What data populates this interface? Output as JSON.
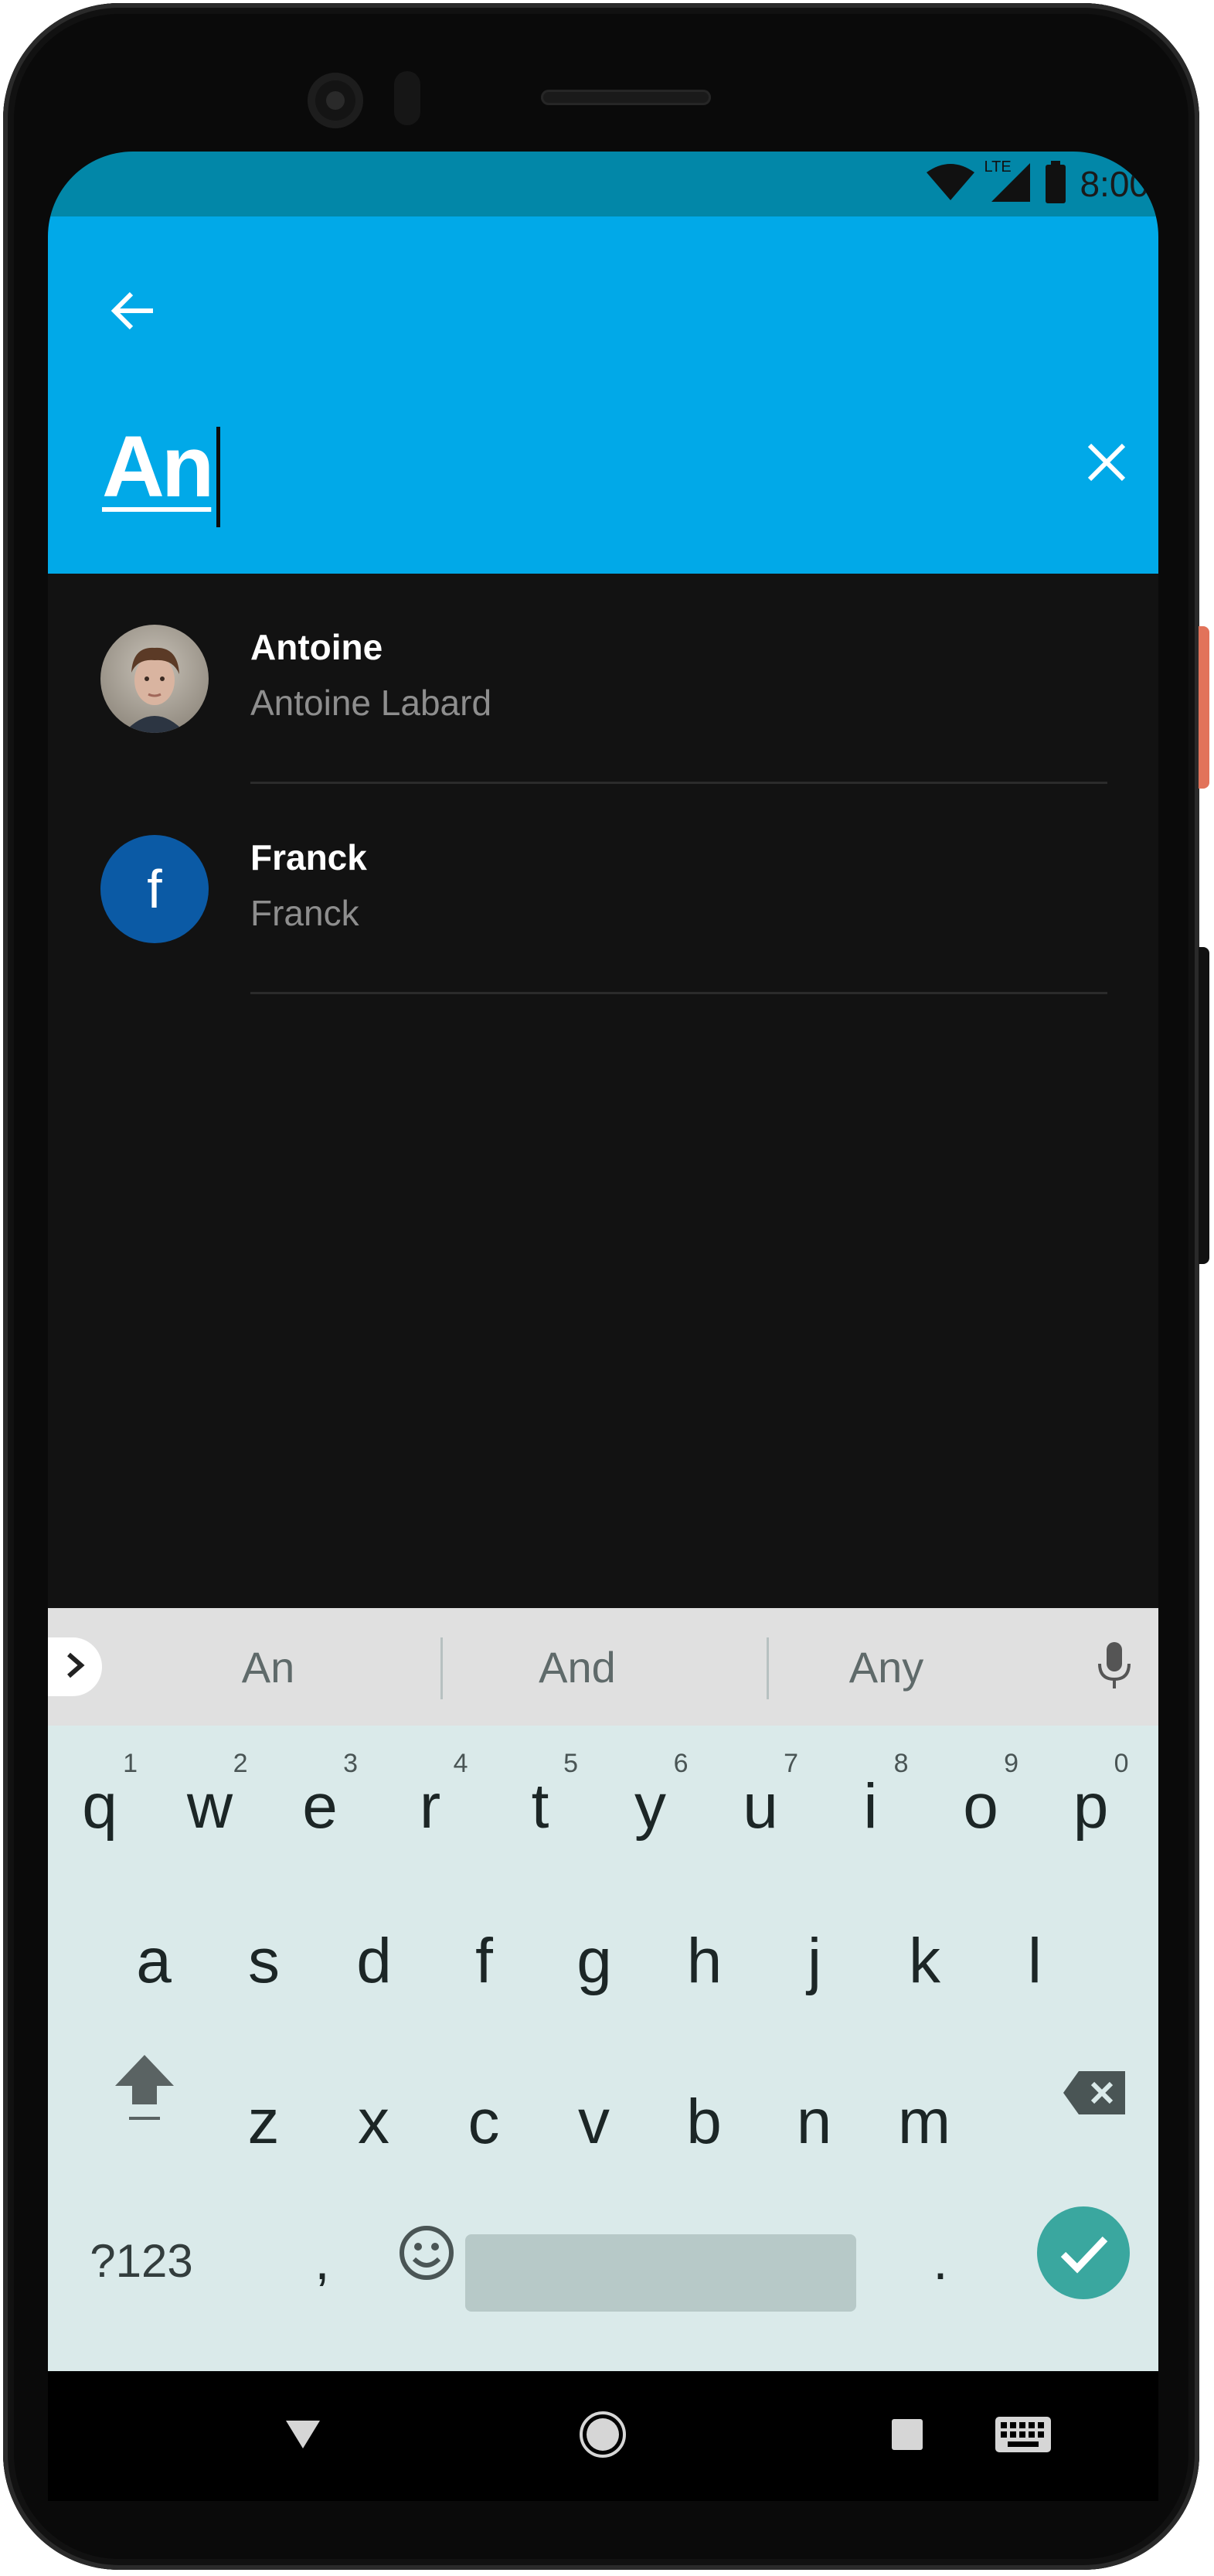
{
  "status_bar": {
    "time": "8:00",
    "network_label": "LTE",
    "icons": [
      "wifi-icon",
      "cell-signal-icon",
      "battery-icon"
    ]
  },
  "app_bar": {
    "search_query": "An",
    "icons": [
      "back-arrow-icon",
      "close-icon"
    ]
  },
  "results": [
    {
      "title": "Antoine",
      "subtitle": "Antoine Labard",
      "avatar": "photo"
    },
    {
      "title": "Franck",
      "subtitle": "Franck",
      "avatar_initial": "f"
    }
  ],
  "keyboard": {
    "suggestions": [
      "An",
      "And",
      "Any"
    ],
    "row1": [
      {
        "ch": "q",
        "hint": "1"
      },
      {
        "ch": "w",
        "hint": "2"
      },
      {
        "ch": "e",
        "hint": "3"
      },
      {
        "ch": "r",
        "hint": "4"
      },
      {
        "ch": "t",
        "hint": "5"
      },
      {
        "ch": "y",
        "hint": "6"
      },
      {
        "ch": "u",
        "hint": "7"
      },
      {
        "ch": "i",
        "hint": "8"
      },
      {
        "ch": "o",
        "hint": "9"
      },
      {
        "ch": "p",
        "hint": "0"
      }
    ],
    "row2": [
      "a",
      "s",
      "d",
      "f",
      "g",
      "h",
      "j",
      "k",
      "l"
    ],
    "row3": [
      "z",
      "x",
      "c",
      "v",
      "b",
      "n",
      "m"
    ],
    "symbols_label": "?123",
    "comma": ",",
    "period": "."
  },
  "colors": {
    "app_bar": "#01a9e8",
    "status_bar": "#0287a8",
    "background": "#121212",
    "keyboard": "#daeaea",
    "enter_key": "#3aa79f",
    "avatar_initial_bg": "#0b5aa5"
  },
  "nav_bar": {
    "icons": [
      "back-triangle-icon",
      "home-circle-icon",
      "recents-square-icon",
      "keyboard-icon"
    ]
  }
}
